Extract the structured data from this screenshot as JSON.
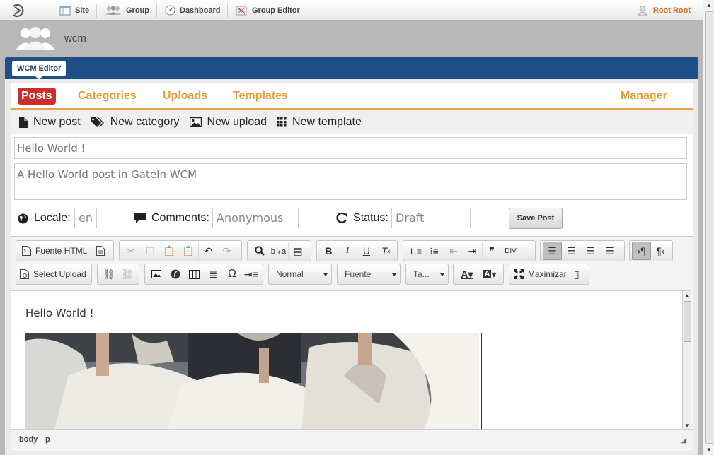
{
  "topbar": {
    "nav": [
      {
        "label": "Site",
        "icon": "site-icon"
      },
      {
        "label": "Group",
        "icon": "group-icon"
      },
      {
        "label": "Dashboard",
        "icon": "dashboard-icon"
      },
      {
        "label": "Group Editor",
        "icon": "group-editor-icon"
      }
    ],
    "user": "Root Root"
  },
  "group": {
    "name": "wcm"
  },
  "portlet": {
    "tab": "WCM Editor"
  },
  "tabs": {
    "posts": "Posts",
    "categories": "Categories",
    "uploads": "Uploads",
    "templates": "Templates",
    "manager": "Manager",
    "active": "Posts"
  },
  "actions": {
    "new_post": "New post",
    "new_category": "New category",
    "new_upload": "New upload",
    "new_template": "New template"
  },
  "post": {
    "title": "Hello World !",
    "excerpt": "A Hello World post in GateIn WCM",
    "locale_label": "Locale:",
    "locale": "en",
    "comments_label": "Comments:",
    "comments": "Anonymous",
    "status_label": "Status:",
    "status": "Draft",
    "save": "Save Post"
  },
  "editor": {
    "source_html": "Fuente HTML",
    "select_upload": "Select Upload",
    "maximize": "Maximizar",
    "format": "Normal",
    "font": "Fuente",
    "size": "Ta...",
    "content_text": "Hello World !",
    "path": [
      "body",
      "p"
    ]
  },
  "colors": {
    "brand_blue": "#1e4f86",
    "accent_orange": "#e0a13c",
    "active_red": "#c9302c"
  }
}
